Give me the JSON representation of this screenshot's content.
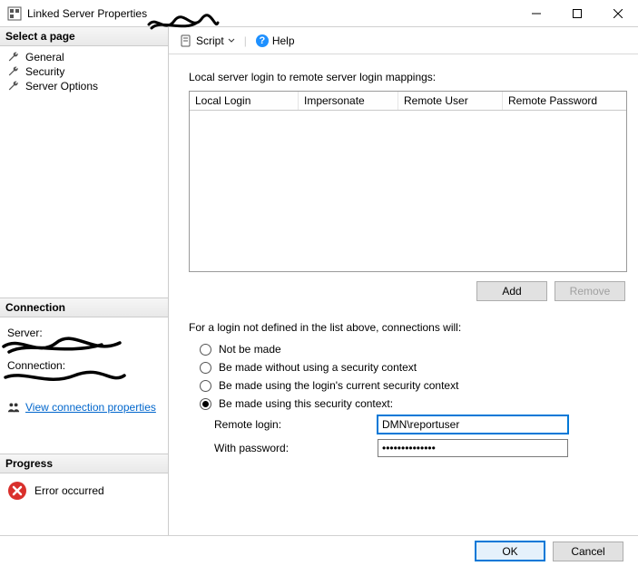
{
  "window": {
    "title": "Linked Server Properties"
  },
  "sidebar": {
    "select_page_header": "Select a page",
    "pages": [
      {
        "label": "General"
      },
      {
        "label": "Security"
      },
      {
        "label": "Server Options"
      }
    ],
    "connection_header": "Connection",
    "server_label": "Server:",
    "connection_label": "Connection:",
    "view_properties_link": "View connection properties",
    "progress_header": "Progress",
    "progress_status": "Error occurred"
  },
  "toolbar": {
    "script_label": "Script",
    "help_label": "Help"
  },
  "mappings": {
    "intro": "Local server login to remote server login mappings:",
    "headers": {
      "local_login": "Local Login",
      "impersonate": "Impersonate",
      "remote_user": "Remote User",
      "remote_password": "Remote Password"
    },
    "add_button": "Add",
    "remove_button": "Remove"
  },
  "options": {
    "intro": "For a login not defined in the list above, connections will:",
    "not_made": "Not be made",
    "no_context": "Be made without using a security context",
    "current_context": "Be made using the login's current security context",
    "this_context": "Be made using this security context:",
    "selected": "this_context",
    "remote_login_label": "Remote login:",
    "remote_login_value": "DMN\\reportuser",
    "password_label": "With password:",
    "password_value": "••••••••••••••"
  },
  "footer": {
    "ok": "OK",
    "cancel": "Cancel"
  }
}
